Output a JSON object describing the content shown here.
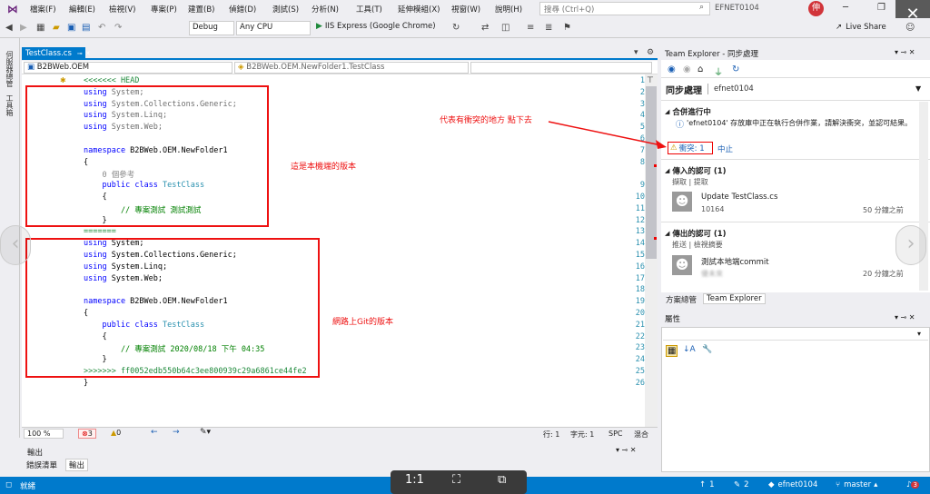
{
  "menu": {
    "items": [
      "檔案(F)",
      "編輯(E)",
      "檢視(V)",
      "專案(P)",
      "建置(B)",
      "偵錯(D)",
      "測試(S)",
      "分析(N)",
      "工具(T)",
      "延伸模組(X)",
      "視窗(W)",
      "說明(H)"
    ],
    "search_placeholder": "搜尋 (Ctrl+Q)",
    "project_name": "EFNET0104",
    "avatar_initial": "伸"
  },
  "toolbar": {
    "config": "Debug",
    "platform": "Any CPU",
    "run_label": "IIS Express (Google Chrome)",
    "live_share": "Live Share"
  },
  "editor": {
    "tab": "TestClass.cs",
    "nav_project": "B2BWeb.OEM",
    "nav_class": "B2BWeb.OEM.NewFolder1.TestClass",
    "zoom": "100 %",
    "errors": "3",
    "warnings": "0",
    "line": "行: 1",
    "char": "字元: 1",
    "spc": "SPC",
    "mix": "混合",
    "lines": [
      {
        "n": "1",
        "t": "<<<<<<< HEAD"
      },
      {
        "n": "2",
        "t": "using System;"
      },
      {
        "n": "3",
        "t": "using System.Collections.Generic;"
      },
      {
        "n": "4",
        "t": "using System.Linq;"
      },
      {
        "n": "5",
        "t": "using System.Web;"
      },
      {
        "n": "6",
        "t": ""
      },
      {
        "n": "7",
        "t": "namespace B2BWeb.OEM.NewFolder1"
      },
      {
        "n": "8",
        "t": "{"
      },
      {
        "n": "",
        "t": "    0 個參考"
      },
      {
        "n": "9",
        "t": "    public class TestClass"
      },
      {
        "n": "10",
        "t": "    {"
      },
      {
        "n": "11",
        "t": "        // 專案測試 測試測試"
      },
      {
        "n": "12",
        "t": "    }"
      },
      {
        "n": "13",
        "t": "======="
      },
      {
        "n": "14",
        "t": "using System;"
      },
      {
        "n": "15",
        "t": "using System.Collections.Generic;"
      },
      {
        "n": "16",
        "t": "using System.Linq;"
      },
      {
        "n": "17",
        "t": "using System.Web;"
      },
      {
        "n": "18",
        "t": ""
      },
      {
        "n": "19",
        "t": "namespace B2BWeb.OEM.NewFolder1"
      },
      {
        "n": "20",
        "t": "{"
      },
      {
        "n": "21",
        "t": "    public class TestClass"
      },
      {
        "n": "22",
        "t": "    {"
      },
      {
        "n": "23",
        "t": "        // 專案測試 2020/08/18 下午 04:35"
      },
      {
        "n": "24",
        "t": "    }"
      },
      {
        "n": "25",
        "t": ">>>>>>> ff0052edb550b64c3ee800939c29a6861ce44fe2"
      },
      {
        "n": "26",
        "t": "}"
      }
    ]
  },
  "annotations": {
    "local_version": "這是本機端的版本",
    "remote_version": "網路上Git的版本",
    "conflict_hint": "代表有衝突的地方 點下去"
  },
  "output": {
    "title": "輸出",
    "tab_errors": "錯誤清單",
    "tab_output": "輸出"
  },
  "team_explorer": {
    "header": "Team Explorer - 同步處理",
    "title": "同步處理",
    "branch": "efnet0104",
    "merge_section": "合併進行中",
    "merge_message": "'efnet0104' 存放庫中正在執行合併作業，請解決衝突，並認可結果。",
    "conflicts_link": "衝突: 1",
    "abort_link": "中止",
    "incoming_section": "傳入的認可 (1)",
    "incoming_links": "擷取 | 提取",
    "incoming_commit": "Update TestClass.cs",
    "incoming_id": "10164",
    "incoming_time": "50 分鐘之前",
    "outgoing_section": "傳出的認可 (1)",
    "outgoing_links": "推送 | 檢視摘要",
    "outgoing_commit": "測試本地端commit",
    "outgoing_id": "優未來",
    "outgoing_time": "20 分鐘之前",
    "tab_solution": "方案總管",
    "tab_te": "Team Explorer"
  },
  "properties": {
    "title": "屬性"
  },
  "statusbar": {
    "ready": "就緒",
    "up": "1",
    "pencil": "2",
    "repo": "efnet0104",
    "branch": "master",
    "notif": "3"
  },
  "viewer": {
    "ratio": "1:1"
  }
}
